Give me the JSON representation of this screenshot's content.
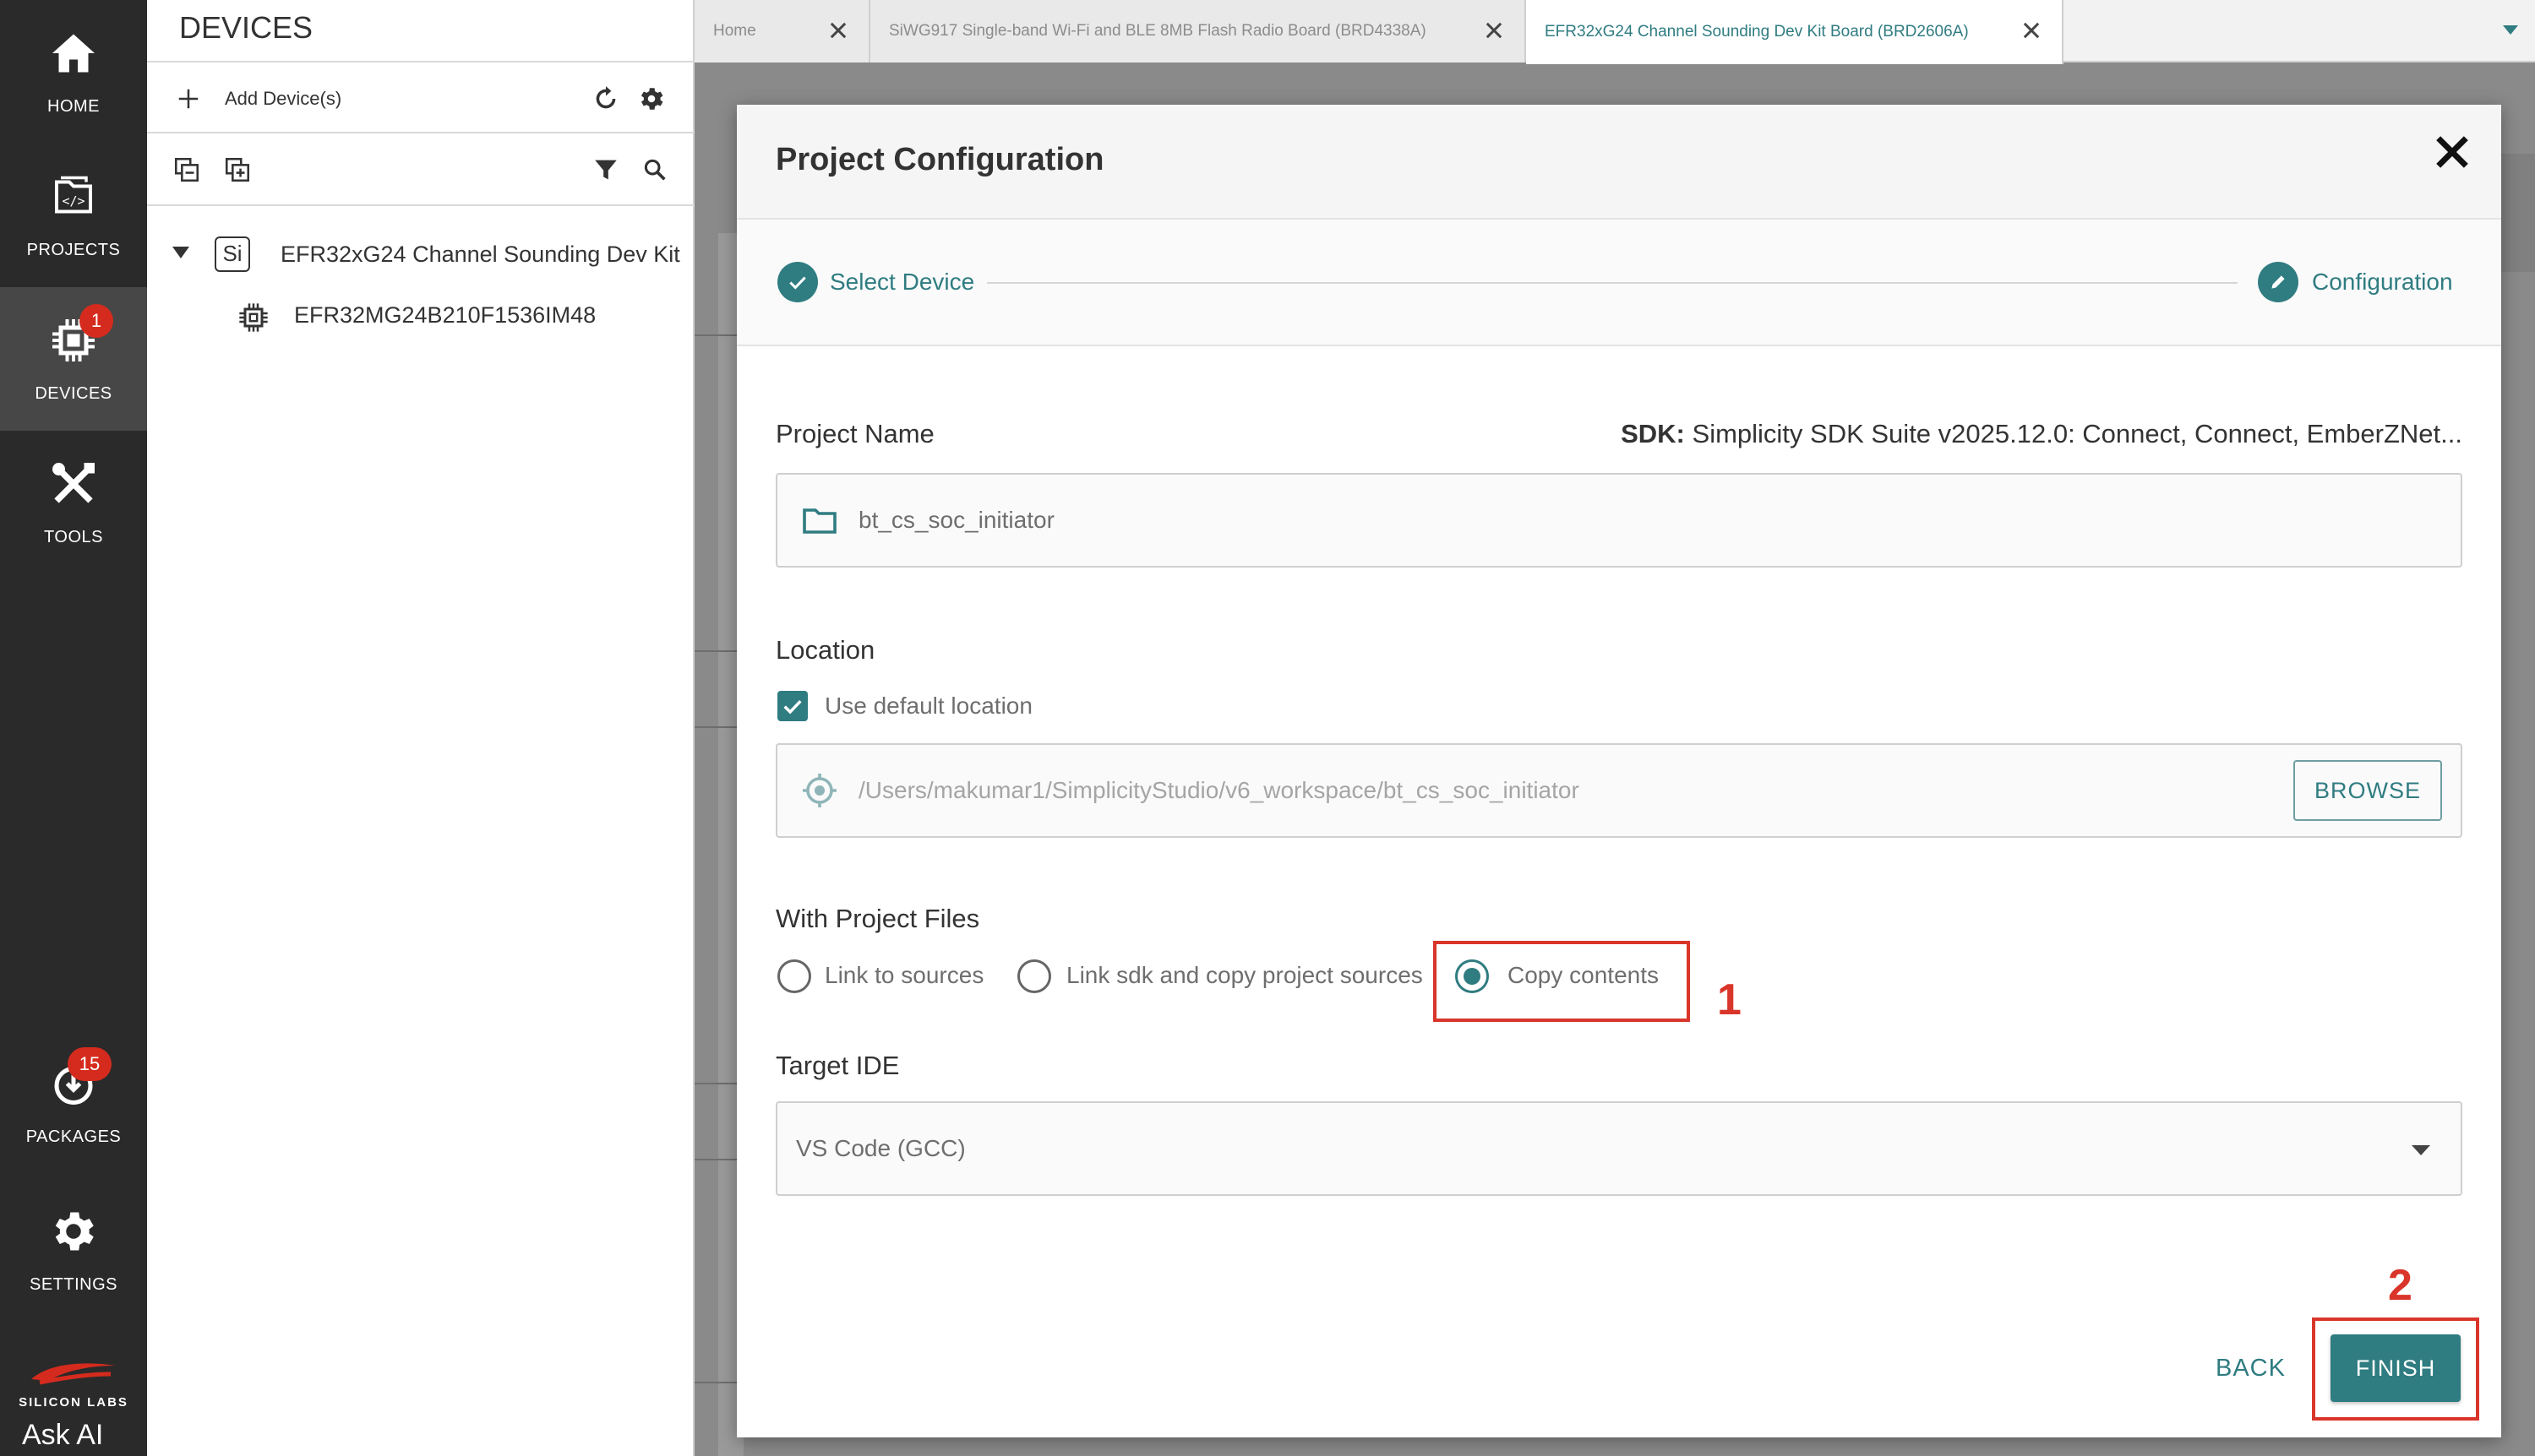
{
  "nav": {
    "items": [
      {
        "label": "HOME",
        "icon": "home-icon"
      },
      {
        "label": "PROJECTS",
        "icon": "projects-icon"
      },
      {
        "label": "DEVICES",
        "icon": "chip-icon",
        "badge": "1"
      },
      {
        "label": "TOOLS",
        "icon": "tools-icon"
      },
      {
        "label": "PACKAGES",
        "icon": "packages-icon",
        "badge": "15"
      },
      {
        "label": "SETTINGS",
        "icon": "gear-icon"
      }
    ],
    "brand": "SILICON LABS",
    "ask_ai": "Ask AI"
  },
  "devices_panel": {
    "title": "DEVICES",
    "add_label": "Add Device(s)",
    "tree": [
      {
        "icon_text": "Si",
        "label": "EFR32xG24 Channel Sounding Dev Kit"
      },
      {
        "label": "EFR32MG24B210F1536IM48"
      }
    ]
  },
  "tabs": [
    {
      "label": "Home"
    },
    {
      "label": "SiWG917 Single-band Wi-Fi and BLE 8MB Flash Radio Board (BRD4338A)"
    },
    {
      "label": "EFR32xG24 Channel Sounding Dev Kit Board (BRD2606A)",
      "active": true
    }
  ],
  "modal": {
    "title": "Project Configuration",
    "steps": [
      {
        "label": "Select Device",
        "state": "done"
      },
      {
        "label": "Configuration",
        "state": "current"
      }
    ],
    "project_name": {
      "label": "Project Name",
      "value": "bt_cs_soc_initiator"
    },
    "sdk": {
      "label": "SDK:",
      "value": "Simplicity SDK Suite v2025.12.0: Connect, Connect, EmberZNet..."
    },
    "location": {
      "label": "Location",
      "use_default_label": "Use default location",
      "use_default_checked": true,
      "path": "/Users/makumar1/SimplicityStudio/v6_workspace/bt_cs_soc_initiator",
      "browse_label": "BROWSE"
    },
    "project_files": {
      "label": "With Project Files",
      "options": [
        "Link to sources",
        "Link sdk and copy project sources",
        "Copy contents"
      ],
      "selected": "Copy contents"
    },
    "target_ide": {
      "label": "Target IDE",
      "value": "VS Code (GCC)"
    },
    "back_label": "BACK",
    "finish_label": "FINISH"
  },
  "annotations": [
    "1",
    "2"
  ],
  "colors": {
    "accent": "#2f7c81",
    "annotation": "#d9352a",
    "badge": "#d52b1e",
    "nav_bg": "#2a2a2a"
  }
}
